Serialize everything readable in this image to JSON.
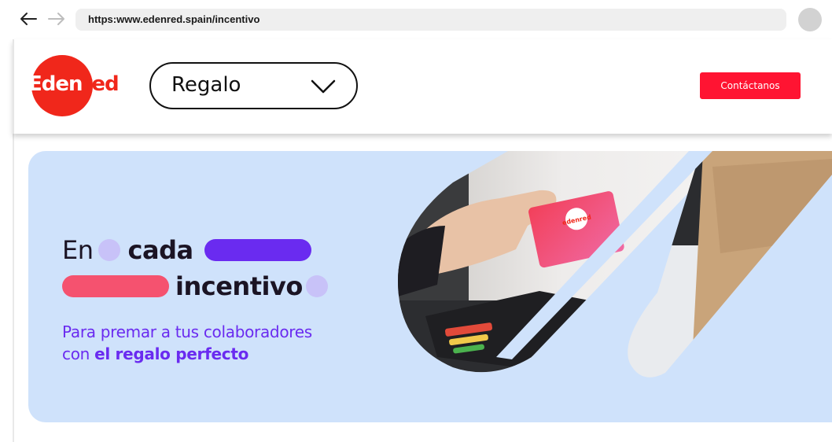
{
  "browser": {
    "url": "https:www.edenred.spain/incentivo",
    "back_icon": "arrow-left-icon",
    "forward_icon": "arrow-right-icon"
  },
  "header": {
    "logo_text_lead": "Eden",
    "logo_text_tail": "red",
    "product_select": {
      "value": "Regalo",
      "icon": "chevron-down-icon"
    },
    "contact_label": "Contáctanos"
  },
  "hero": {
    "headline": {
      "word_1": "En",
      "word_2": "cada",
      "word_3": "incentivo"
    },
    "subtitle_line_1": "Para premar a tus colaboradores",
    "subtitle_line_2_plain": "con ",
    "subtitle_line_2_strong": "el regalo perfecto",
    "card_logo_text": "edenred"
  },
  "colors": {
    "brand_red": "#f0271b",
    "cta_red": "#ff1432",
    "hero_bg": "#cfe2fb",
    "accent_purple": "#6a2bf0",
    "accent_pink": "#f5526f",
    "accent_lilac": "#c8c2f8"
  }
}
